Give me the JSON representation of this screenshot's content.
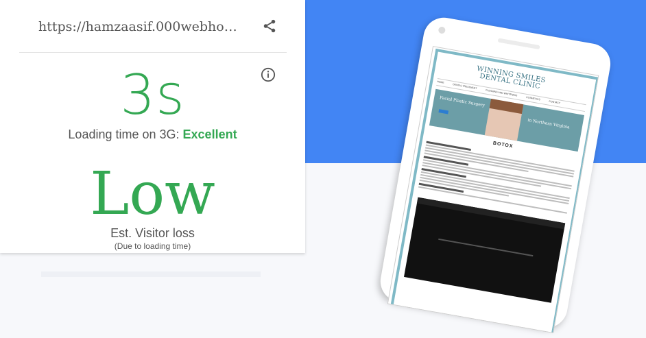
{
  "report": {
    "url": "https://hamzaasif.000webho…",
    "load_time": "3s",
    "loading_prefix": "Loading time on 3G: ",
    "loading_rating": "Excellent",
    "visitor_loss": "Low",
    "visitor_loss_label": "Est. Visitor loss",
    "visitor_loss_note": "(Due to loading time)"
  },
  "preview_site": {
    "logo_line1": "WINNING SMILES",
    "logo_line2": "DENTAL CLINIC",
    "nav": [
      "HOME",
      "DENTAL TREATMENT",
      "CLEANING AND WHITENING",
      "COSMETICS",
      "CONTACT"
    ],
    "hero_left": "Facial Plastic Surgery",
    "hero_right": "in Northern Virginia",
    "page_heading": "BOTOX"
  },
  "colors": {
    "blue_bg": "#4285f4",
    "good_green": "#34a853",
    "text_gray": "#555555"
  },
  "icons": {
    "share": "share-icon",
    "info": "info-icon"
  }
}
